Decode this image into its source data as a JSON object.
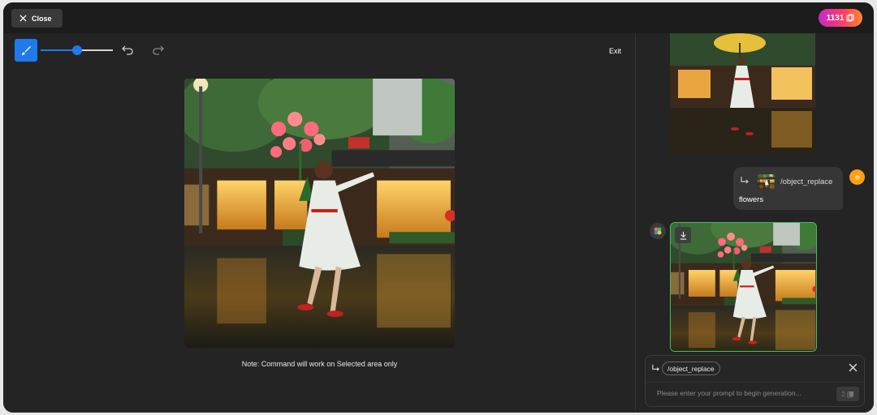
{
  "header": {
    "close_label": "Close",
    "credits": "1131"
  },
  "toolbar": {
    "brush_size": 0.5,
    "exit_label": "Exit"
  },
  "editor": {
    "note": "Note: Command will work on Selected area only"
  },
  "chat": {
    "messages": [
      {
        "role": "user",
        "command": "/object_replace",
        "text": "flowers"
      }
    ]
  },
  "composer": {
    "command_chip": "/object_replace",
    "placeholder": "Please enter your prompt to begin generation...",
    "cost": "2"
  },
  "colors": {
    "accent": "#1f7aeb",
    "success": "#3cc35a",
    "credit_gradient_start": "#c02cc8",
    "credit_gradient_end": "#ff8a2a"
  }
}
